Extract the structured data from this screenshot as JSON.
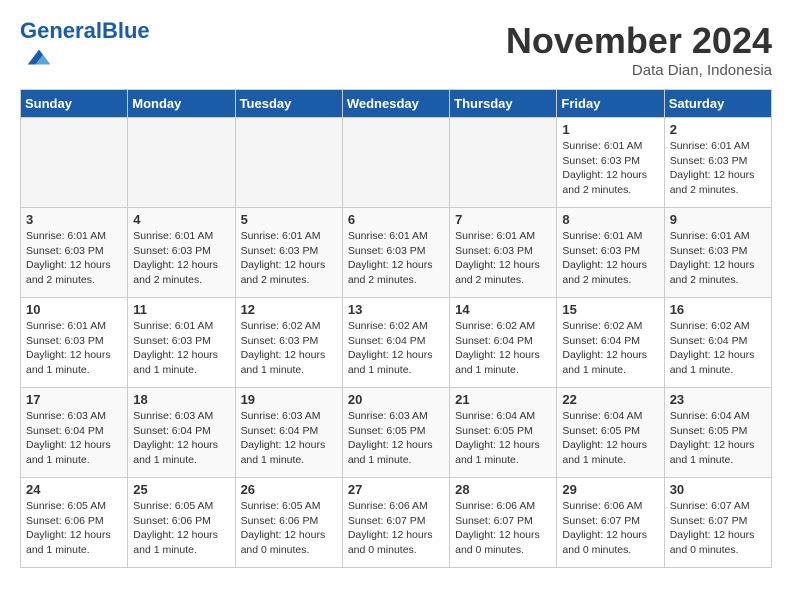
{
  "header": {
    "logo_general": "General",
    "logo_blue": "Blue",
    "month_title": "November 2024",
    "location": "Data Dian, Indonesia"
  },
  "weekdays": [
    "Sunday",
    "Monday",
    "Tuesday",
    "Wednesday",
    "Thursday",
    "Friday",
    "Saturday"
  ],
  "weeks": [
    [
      {
        "day": "",
        "info": ""
      },
      {
        "day": "",
        "info": ""
      },
      {
        "day": "",
        "info": ""
      },
      {
        "day": "",
        "info": ""
      },
      {
        "day": "",
        "info": ""
      },
      {
        "day": "1",
        "info": "Sunrise: 6:01 AM\nSunset: 6:03 PM\nDaylight: 12 hours and 2 minutes."
      },
      {
        "day": "2",
        "info": "Sunrise: 6:01 AM\nSunset: 6:03 PM\nDaylight: 12 hours and 2 minutes."
      }
    ],
    [
      {
        "day": "3",
        "info": "Sunrise: 6:01 AM\nSunset: 6:03 PM\nDaylight: 12 hours and 2 minutes."
      },
      {
        "day": "4",
        "info": "Sunrise: 6:01 AM\nSunset: 6:03 PM\nDaylight: 12 hours and 2 minutes."
      },
      {
        "day": "5",
        "info": "Sunrise: 6:01 AM\nSunset: 6:03 PM\nDaylight: 12 hours and 2 minutes."
      },
      {
        "day": "6",
        "info": "Sunrise: 6:01 AM\nSunset: 6:03 PM\nDaylight: 12 hours and 2 minutes."
      },
      {
        "day": "7",
        "info": "Sunrise: 6:01 AM\nSunset: 6:03 PM\nDaylight: 12 hours and 2 minutes."
      },
      {
        "day": "8",
        "info": "Sunrise: 6:01 AM\nSunset: 6:03 PM\nDaylight: 12 hours and 2 minutes."
      },
      {
        "day": "9",
        "info": "Sunrise: 6:01 AM\nSunset: 6:03 PM\nDaylight: 12 hours and 2 minutes."
      }
    ],
    [
      {
        "day": "10",
        "info": "Sunrise: 6:01 AM\nSunset: 6:03 PM\nDaylight: 12 hours and 1 minute."
      },
      {
        "day": "11",
        "info": "Sunrise: 6:01 AM\nSunset: 6:03 PM\nDaylight: 12 hours and 1 minute."
      },
      {
        "day": "12",
        "info": "Sunrise: 6:02 AM\nSunset: 6:03 PM\nDaylight: 12 hours and 1 minute."
      },
      {
        "day": "13",
        "info": "Sunrise: 6:02 AM\nSunset: 6:04 PM\nDaylight: 12 hours and 1 minute."
      },
      {
        "day": "14",
        "info": "Sunrise: 6:02 AM\nSunset: 6:04 PM\nDaylight: 12 hours and 1 minute."
      },
      {
        "day": "15",
        "info": "Sunrise: 6:02 AM\nSunset: 6:04 PM\nDaylight: 12 hours and 1 minute."
      },
      {
        "day": "16",
        "info": "Sunrise: 6:02 AM\nSunset: 6:04 PM\nDaylight: 12 hours and 1 minute."
      }
    ],
    [
      {
        "day": "17",
        "info": "Sunrise: 6:03 AM\nSunset: 6:04 PM\nDaylight: 12 hours and 1 minute."
      },
      {
        "day": "18",
        "info": "Sunrise: 6:03 AM\nSunset: 6:04 PM\nDaylight: 12 hours and 1 minute."
      },
      {
        "day": "19",
        "info": "Sunrise: 6:03 AM\nSunset: 6:04 PM\nDaylight: 12 hours and 1 minute."
      },
      {
        "day": "20",
        "info": "Sunrise: 6:03 AM\nSunset: 6:05 PM\nDaylight: 12 hours and 1 minute."
      },
      {
        "day": "21",
        "info": "Sunrise: 6:04 AM\nSunset: 6:05 PM\nDaylight: 12 hours and 1 minute."
      },
      {
        "day": "22",
        "info": "Sunrise: 6:04 AM\nSunset: 6:05 PM\nDaylight: 12 hours and 1 minute."
      },
      {
        "day": "23",
        "info": "Sunrise: 6:04 AM\nSunset: 6:05 PM\nDaylight: 12 hours and 1 minute."
      }
    ],
    [
      {
        "day": "24",
        "info": "Sunrise: 6:05 AM\nSunset: 6:06 PM\nDaylight: 12 hours and 1 minute."
      },
      {
        "day": "25",
        "info": "Sunrise: 6:05 AM\nSunset: 6:06 PM\nDaylight: 12 hours and 1 minute."
      },
      {
        "day": "26",
        "info": "Sunrise: 6:05 AM\nSunset: 6:06 PM\nDaylight: 12 hours and 0 minutes."
      },
      {
        "day": "27",
        "info": "Sunrise: 6:06 AM\nSunset: 6:07 PM\nDaylight: 12 hours and 0 minutes."
      },
      {
        "day": "28",
        "info": "Sunrise: 6:06 AM\nSunset: 6:07 PM\nDaylight: 12 hours and 0 minutes."
      },
      {
        "day": "29",
        "info": "Sunrise: 6:06 AM\nSunset: 6:07 PM\nDaylight: 12 hours and 0 minutes."
      },
      {
        "day": "30",
        "info": "Sunrise: 6:07 AM\nSunset: 6:07 PM\nDaylight: 12 hours and 0 minutes."
      }
    ]
  ]
}
